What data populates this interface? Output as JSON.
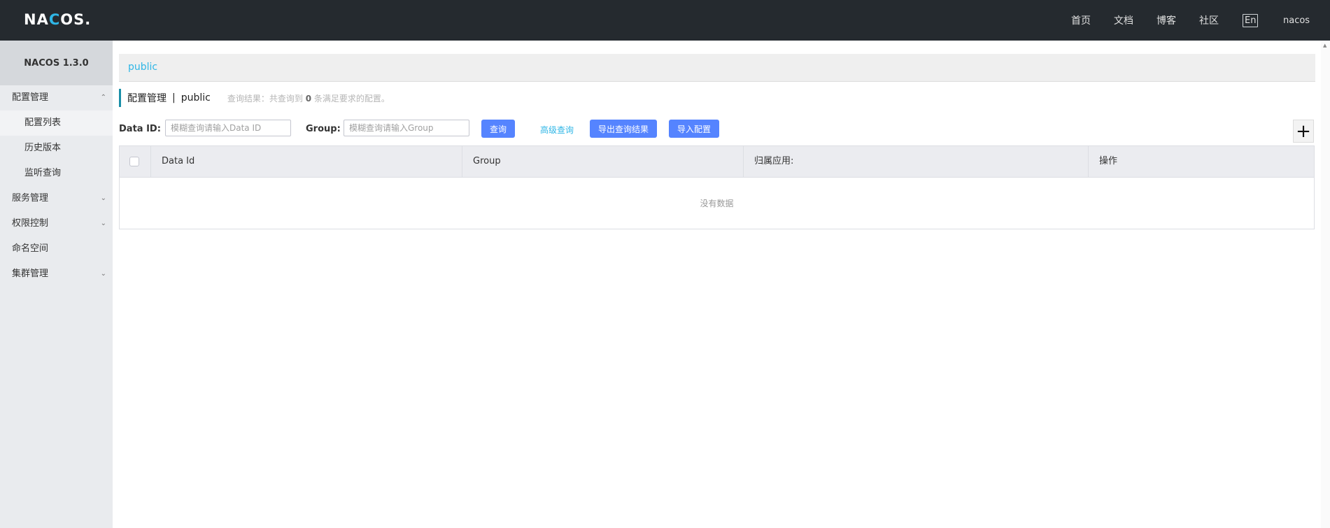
{
  "header": {
    "logo_left": "NA",
    "logo_accent": "C",
    "logo_right": "OS.",
    "nav": [
      "首页",
      "文档",
      "博客",
      "社区"
    ],
    "lang": "En",
    "user": "nacos"
  },
  "sidebar": {
    "title": "NACOS 1.3.0",
    "items": [
      {
        "label": "配置管理"
      },
      {
        "label": "配置列表"
      },
      {
        "label": "历史版本"
      },
      {
        "label": "监听查询"
      },
      {
        "label": "服务管理"
      },
      {
        "label": "权限控制"
      },
      {
        "label": "命名空间"
      },
      {
        "label": "集群管理"
      }
    ]
  },
  "main": {
    "breadcrumb": "public",
    "title": "配置管理",
    "title_sep": "|",
    "namespace": "public",
    "result_prefix": "查询结果：共查询到",
    "result_count": "0",
    "result_suffix": "条满足要求的配置。",
    "filters": {
      "dataid_label": "Data ID:",
      "dataid_placeholder": "模糊查询请输入Data ID",
      "group_label": "Group:",
      "group_placeholder": "模糊查询请输入Group",
      "query_button": "查询",
      "advanced_link": "高级查询",
      "export_button": "导出查询结果",
      "import_button": "导入配置",
      "add_button": "+"
    },
    "table": {
      "columns": [
        "Data Id",
        "Group",
        "归属应用:",
        "操作"
      ],
      "empty_text": "没有数据"
    }
  }
}
